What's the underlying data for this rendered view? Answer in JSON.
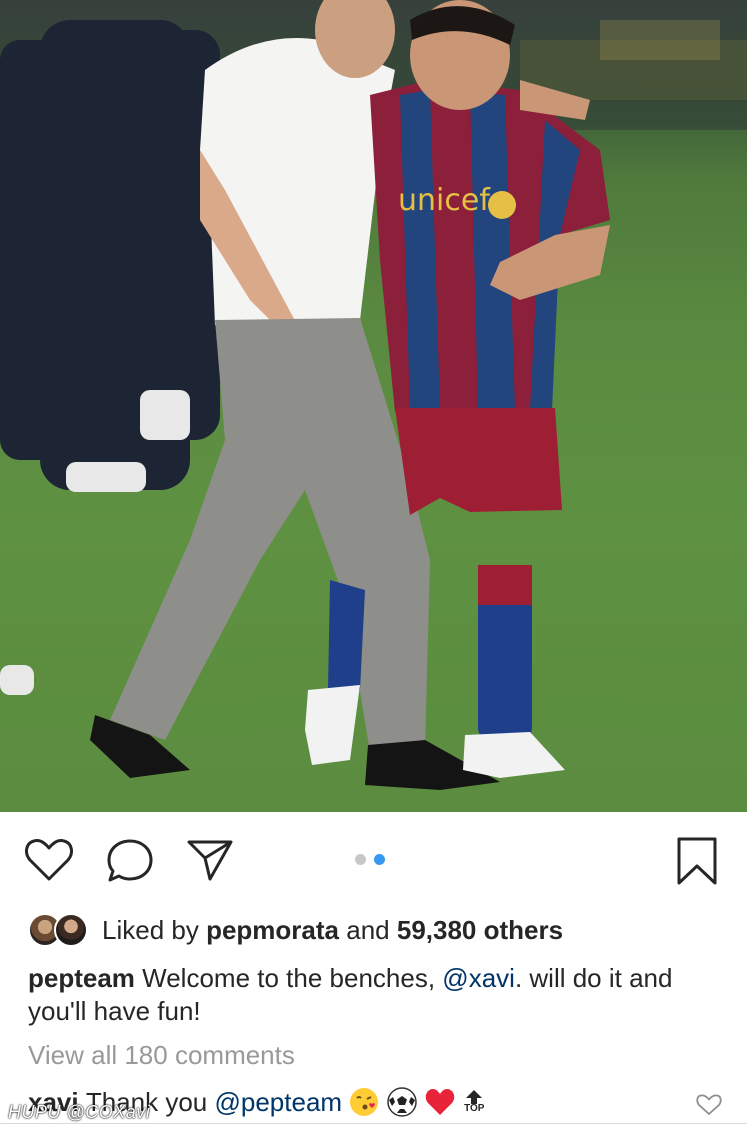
{
  "post": {
    "photo_alt": "",
    "carousel": {
      "count": 2,
      "active": 2
    }
  },
  "actions": {
    "like_icon": "heart-outline-icon",
    "comment_icon": "speech-bubble-icon",
    "share_icon": "paper-plane-icon",
    "save_icon": "bookmark-icon"
  },
  "likes": {
    "prefix": "Liked by",
    "first_user": "pepmorata",
    "joiner": "and",
    "others_count": "59,380 others"
  },
  "caption": {
    "username": "pepteam",
    "text_before": "Welcome to the benches,",
    "mention": "@xavi",
    "text_after": ". will do it and you'll have fun!"
  },
  "view_all": "View all 180 comments",
  "top_comment": {
    "username": "xavi",
    "text": "Thank you",
    "mention": "@pepteam",
    "top_label": "TOP"
  },
  "watermark": "HUPU @COXavi",
  "colors": {
    "link": "#003569",
    "muted": "#999999",
    "carousel_active": "#3897f0",
    "carousel_inactive": "#c7c7c7"
  }
}
